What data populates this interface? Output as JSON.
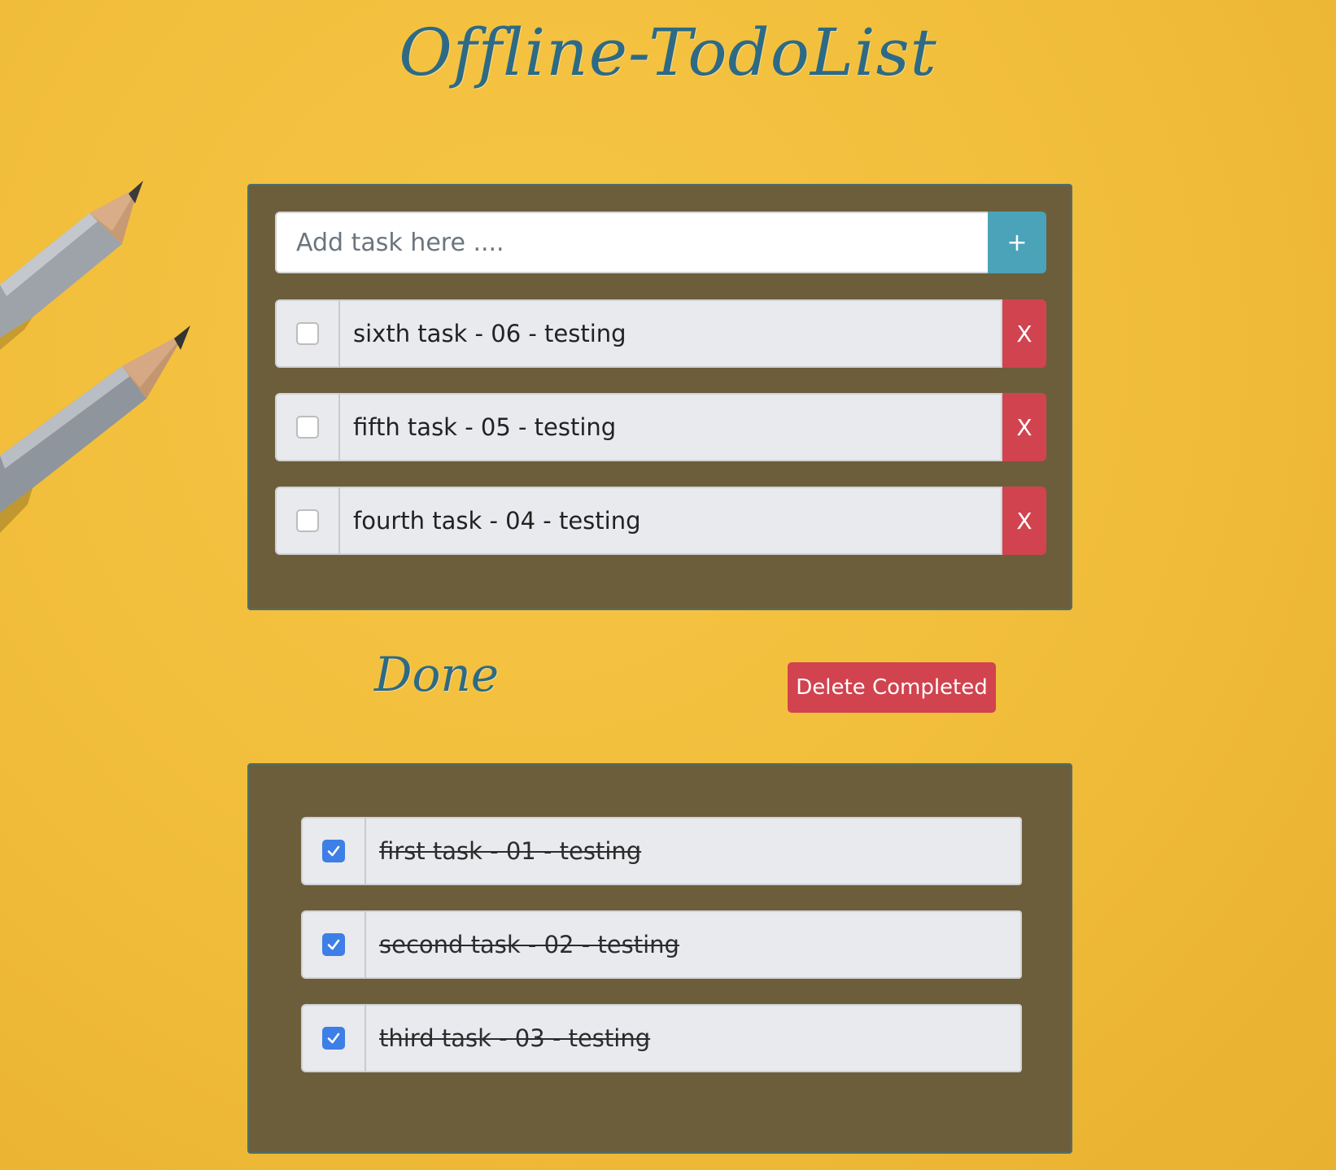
{
  "app": {
    "title": "Offline-TodoList"
  },
  "add_task": {
    "placeholder": "Add task here ....",
    "value": "",
    "add_label": "+"
  },
  "todo": {
    "items": [
      {
        "text": "sixth task - 06 - testing",
        "checked": false,
        "delete_label": "X"
      },
      {
        "text": "fifth task - 05 - testing",
        "checked": false,
        "delete_label": "X"
      },
      {
        "text": "fourth task - 04 - testing",
        "checked": false,
        "delete_label": "X"
      }
    ]
  },
  "done": {
    "heading": "Done",
    "delete_completed_label": "Delete Completed",
    "items": [
      {
        "text": "first task - 01 - testing",
        "checked": true
      },
      {
        "text": "second task - 02 - testing",
        "checked": true
      },
      {
        "text": "third task - 03 - testing",
        "checked": true
      }
    ]
  },
  "colors": {
    "background": "#f2bf3c",
    "panel": "#6c5e3b",
    "title": "#2d6a85",
    "add_button": "#4aa3b8",
    "danger": "#d1434f",
    "checkbox_checked": "#3d7fe6"
  },
  "icons": {
    "decoration": "pencils-decoration",
    "check": "checkmark-icon"
  }
}
